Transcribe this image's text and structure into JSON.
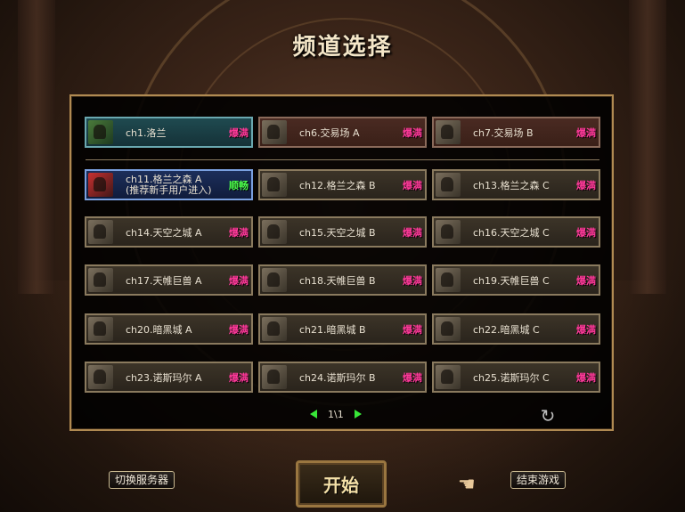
{
  "title": "频道选择",
  "channels": [
    {
      "name": "ch1.洛兰",
      "name2": "",
      "status": "爆满",
      "status_type": "full",
      "style": "teal"
    },
    {
      "name": "ch6.交易场 A",
      "name2": "",
      "status": "爆满",
      "status_type": "full",
      "style": "top"
    },
    {
      "name": "ch7.交易场 B",
      "name2": "",
      "status": "爆满",
      "status_type": "full",
      "style": "top"
    },
    {
      "name": "ch11.格兰之森 A",
      "name2": "(推荐新手用户进入)",
      "status": "顺畅",
      "status_type": "good",
      "style": "sel"
    },
    {
      "name": "ch12.格兰之森 B",
      "name2": "",
      "status": "爆满",
      "status_type": "full",
      "style": "normal"
    },
    {
      "name": "ch13.格兰之森 C",
      "name2": "",
      "status": "爆满",
      "status_type": "full",
      "style": "normal"
    },
    {
      "name": "ch14.天空之城 A",
      "name2": "",
      "status": "爆满",
      "status_type": "full",
      "style": "normal"
    },
    {
      "name": "ch15.天空之城 B",
      "name2": "",
      "status": "爆满",
      "status_type": "full",
      "style": "normal"
    },
    {
      "name": "ch16.天空之城 C",
      "name2": "",
      "status": "爆满",
      "status_type": "full",
      "style": "normal"
    },
    {
      "name": "ch17.天帷巨兽 A",
      "name2": "",
      "status": "爆满",
      "status_type": "full",
      "style": "normal"
    },
    {
      "name": "ch18.天帷巨兽 B",
      "name2": "",
      "status": "爆满",
      "status_type": "full",
      "style": "normal"
    },
    {
      "name": "ch19.天帷巨兽 C",
      "name2": "",
      "status": "爆满",
      "status_type": "full",
      "style": "normal"
    },
    {
      "name": "ch20.暗黑城 A",
      "name2": "",
      "status": "爆满",
      "status_type": "full",
      "style": "normal"
    },
    {
      "name": "ch21.暗黑城 B",
      "name2": "",
      "status": "爆满",
      "status_type": "full",
      "style": "normal"
    },
    {
      "name": "ch22.暗黑城 C",
      "name2": "",
      "status": "爆满",
      "status_type": "full",
      "style": "normal"
    },
    {
      "name": "ch23.诺斯玛尔 A",
      "name2": "",
      "status": "爆满",
      "status_type": "full",
      "style": "normal"
    },
    {
      "name": "ch24.诺斯玛尔 B",
      "name2": "",
      "status": "爆满",
      "status_type": "full",
      "style": "normal"
    },
    {
      "name": "ch25.诺斯玛尔 C",
      "name2": "",
      "status": "爆满",
      "status_type": "full",
      "style": "normal"
    }
  ],
  "pager": {
    "text": "1\\1"
  },
  "buttons": {
    "switch_server": "切换服务器",
    "start": "开始",
    "exit_game": "结束游戏"
  },
  "icons": {
    "refresh": "refresh-icon",
    "prev": "arrow-left-icon",
    "next": "arrow-right-icon",
    "cursor": "hand-cursor-icon"
  },
  "colors": {
    "full": "#ff3a9a",
    "good": "#4cff4c",
    "border": "#b08a52"
  }
}
